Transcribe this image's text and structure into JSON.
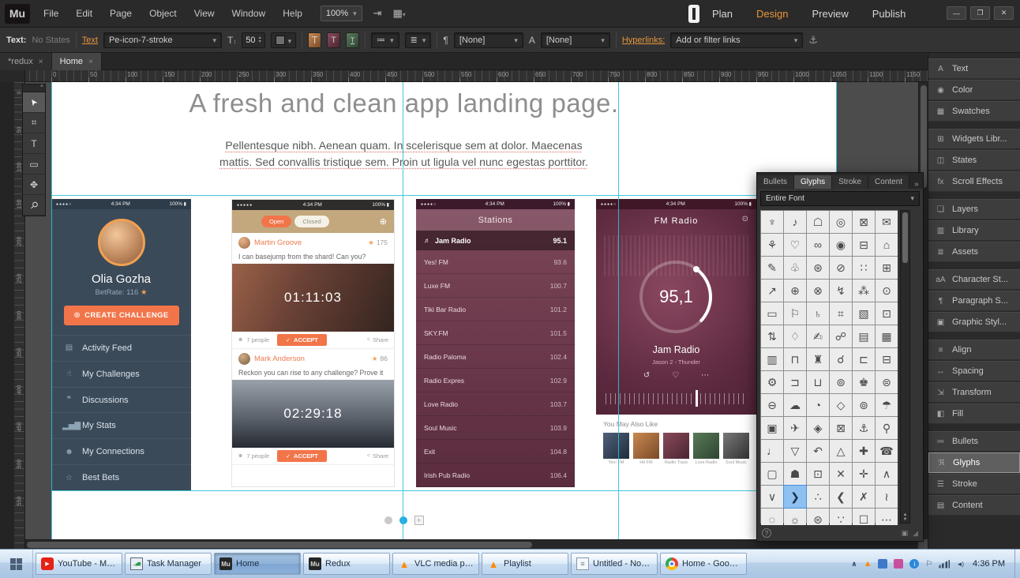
{
  "menubar": {
    "logo": "Mu",
    "menus": [
      "File",
      "Edit",
      "Page",
      "Object",
      "View",
      "Window",
      "Help"
    ],
    "zoom_value": "100%",
    "mode_tabs": [
      {
        "label": "Plan",
        "active": false
      },
      {
        "label": "Design",
        "active": true
      },
      {
        "label": "Preview",
        "active": false
      },
      {
        "label": "Publish",
        "active": false
      }
    ]
  },
  "control_bar": {
    "text_label": "Text:",
    "states_value": "No States",
    "text_link": "Text",
    "font_name": "Pe-icon-7-stroke",
    "font_size": "50",
    "paragraph_style": "[None]",
    "character_style": "[None]",
    "hyperlinks_label": "Hyperlinks:",
    "hyperlinks_value": "Add or filter links"
  },
  "doc_tabs": [
    {
      "label": "*redux",
      "active": false
    },
    {
      "label": "Home",
      "active": true
    }
  ],
  "rulers": {
    "h_labels": [
      "0",
      "50",
      "100",
      "150",
      "200",
      "250",
      "300",
      "350",
      "400",
      "450",
      "500",
      "550",
      "600",
      "650",
      "700",
      "750",
      "800",
      "850",
      "900",
      "950",
      "1000",
      "1050",
      "1100",
      "1150"
    ],
    "v_labels": [
      "0",
      "50",
      "100",
      "150",
      "200",
      "250",
      "300",
      "350",
      "400",
      "450",
      "500",
      "550"
    ]
  },
  "tools": [
    {
      "name": "selection-tool",
      "glyph": "➤"
    },
    {
      "name": "crop-tool",
      "glyph": "⌗"
    },
    {
      "name": "text-tool",
      "glyph": "T"
    },
    {
      "name": "rectangle-tool",
      "glyph": "▭"
    },
    {
      "name": "hand-tool",
      "glyph": "✥"
    },
    {
      "name": "zoom-tool",
      "glyph": "⚲"
    }
  ],
  "icons": {
    "star": "★",
    "people": "☻",
    "check": "✓",
    "share": "<",
    "add": "⊕",
    "speaker": "♬",
    "power": "⊙",
    "repeat": "↺",
    "heart": "♡",
    "more": "⋯"
  },
  "page": {
    "heading": "A fresh and clean app landing page.",
    "body_line1": "Pellentesque nibh. Aenean quam. In scelerisque sem at dolor. Maecenas",
    "body_line2": "mattis. Sed convallis tristique sem. Proin ut ligula vel nunc egestas porttitor."
  },
  "profile_card": {
    "status": {
      "dots": "●●●●○",
      "time": "4:34 PM",
      "battery": "100%"
    },
    "name": "Olia Gozha",
    "betrate_label": "BetRate:",
    "betrate_value": "116",
    "cta": "CREATE CHALLENGE",
    "menu": [
      {
        "icon": "▤",
        "label": "Activity Feed"
      },
      {
        "icon": "☝",
        "label": "My Challenges"
      },
      {
        "icon": "❞",
        "label": "Discussions"
      },
      {
        "icon": "▂▅▇",
        "label": "My Stats"
      },
      {
        "icon": "☻",
        "label": "My Connections"
      },
      {
        "icon": "☆",
        "label": "Best Bets"
      }
    ]
  },
  "challenge_card": {
    "status": {
      "dots": "●●●●●",
      "time": "4:34 PM",
      "battery": "100%"
    },
    "tabs": [
      {
        "label": "Open",
        "active": true
      },
      {
        "label": "Closed",
        "active": false
      }
    ],
    "posts": [
      {
        "name": "Martin Groove",
        "score": "175",
        "text": "I can basejump from the shard! Can you?",
        "timer": "01:11:03",
        "people": "7 people",
        "accept": "ACCEPT",
        "share": "Share"
      },
      {
        "name": "Mark Anderson",
        "score": "86",
        "text": "Reckon you can rise to any challenge? Prove it",
        "timer": "02:29:18",
        "people": "7 people",
        "accept": "ACCEPT",
        "share": "Share"
      }
    ]
  },
  "stations_card": {
    "status": {
      "dots": "●●●●○",
      "time": "4:34 PM",
      "battery": "100%"
    },
    "title": "Stations",
    "now_playing": {
      "name": "Jam Radio",
      "freq": "95.1"
    },
    "stations": [
      {
        "name": "Yes! FM",
        "freq": "93.6"
      },
      {
        "name": "Luxe FM",
        "freq": "100.7"
      },
      {
        "name": "Tiki Bar Radio",
        "freq": "101.2"
      },
      {
        "name": "SKY.FM",
        "freq": "101.5"
      },
      {
        "name": "Radio Paloma",
        "freq": "102.4"
      },
      {
        "name": "Radio Expres",
        "freq": "102.9"
      },
      {
        "name": "Love Radio",
        "freq": "103.7"
      },
      {
        "name": "Soul Music",
        "freq": "103.9"
      },
      {
        "name": "Exit",
        "freq": "104.8"
      },
      {
        "name": "Irish Pub Radio",
        "freq": "106.4"
      }
    ]
  },
  "fm_card": {
    "status": {
      "dots": "●●●●○",
      "time": "4:34 PM",
      "battery": "100%"
    },
    "title": "FM Radio",
    "freq": "95,1",
    "station": "Jam Radio",
    "track": "Jason 2 - Thunder",
    "also_like": "You May Also Like",
    "thumbs": [
      "Yes! FM",
      "Hit FM",
      "Radio Track",
      "Love Radio",
      "Soul Music"
    ]
  },
  "pagination": {
    "add_symbol": "+"
  },
  "glyphs_panel": {
    "tabs": [
      {
        "label": "Bullets",
        "active": false
      },
      {
        "label": "Glyphs",
        "active": true
      },
      {
        "label": "Stroke",
        "active": false
      },
      {
        "label": "Content",
        "active": false
      }
    ],
    "overflow": "»",
    "font_filter": "Entire Font",
    "selected_index": 73,
    "glyphs": [
      "♆",
      "♪",
      "☖",
      "◎",
      "⊠",
      "✉",
      "⚘",
      "♡",
      "∞",
      "◉",
      "⊟",
      "⌂",
      "✎",
      "♧",
      "⊛",
      "⊘",
      "∷",
      "⊞",
      "↗",
      "⊕",
      "⊗",
      "↯",
      "⁂",
      "⊙",
      "▭",
      "⚐",
      "♄",
      "⌗",
      "▧",
      "⊡",
      "⇅",
      "♢",
      "✍",
      "☍",
      "▤",
      "▦",
      "▥",
      "⊓",
      "♜",
      "☌",
      "⊏",
      "⊟",
      "⚙",
      "⊐",
      "⊔",
      "⊚",
      "♚",
      "⊜",
      "⊖",
      "☁",
      "◔",
      "◇",
      "⊚",
      "☂",
      "▣",
      "✈",
      "◈",
      "⊠",
      "⚓",
      "⚲",
      "♩",
      "▽",
      "↶",
      "△",
      "✚",
      "☎",
      "▢",
      "☗",
      "⊡",
      "✕",
      "✛",
      "∧",
      "∨",
      "❯",
      "∴",
      "❮",
      "✗",
      "≀",
      "◌",
      "☼",
      "⊜",
      "∵",
      "☐",
      "⋯"
    ],
    "help": "?"
  },
  "panel_dock": {
    "collapse": "«",
    "active_label": "Glyphs",
    "groups": [
      [
        {
          "icon": "A",
          "label": "Text"
        },
        {
          "icon": "◉",
          "label": "Color"
        },
        {
          "icon": "▦",
          "label": "Swatches"
        }
      ],
      [
        {
          "icon": "⊞",
          "label": "Widgets Libr..."
        },
        {
          "icon": "◫",
          "label": "States"
        },
        {
          "icon": "fx",
          "label": "Scroll Effects"
        }
      ],
      [
        {
          "icon": "❏",
          "label": "Layers"
        },
        {
          "icon": "▥",
          "label": "Library"
        },
        {
          "icon": "≣",
          "label": "Assets"
        }
      ],
      [
        {
          "icon": "aA",
          "label": "Character St..."
        },
        {
          "icon": "¶",
          "label": "Paragraph S..."
        },
        {
          "icon": "▣",
          "label": "Graphic Styl..."
        }
      ],
      [
        {
          "icon": "≡",
          "label": "Align"
        },
        {
          "icon": "↔",
          "label": "Spacing"
        },
        {
          "icon": "⇲",
          "label": "Transform"
        },
        {
          "icon": "◧",
          "label": "Fill"
        }
      ],
      [
        {
          "icon": "≔",
          "label": "Bullets"
        },
        {
          "icon": "ℜ",
          "label": "Glyphs"
        },
        {
          "icon": "☰",
          "label": "Stroke"
        },
        {
          "icon": "▤",
          "label": "Content"
        }
      ]
    ]
  },
  "taskbar": {
    "buttons": [
      {
        "icon": "youtube",
        "label": "YouTube - Mo...",
        "active": false
      },
      {
        "icon": "taskmgr",
        "label": "Task Manager",
        "active": false
      },
      {
        "icon": "muse",
        "label": "Home",
        "active": true
      },
      {
        "icon": "muse",
        "label": "Redux",
        "active": false
      },
      {
        "icon": "vlc",
        "label": "VLC media pla...",
        "active": false
      },
      {
        "icon": "vlc",
        "label": "Playlist",
        "active": false
      },
      {
        "icon": "notepad",
        "label": "Untitled - Note...",
        "active": false
      },
      {
        "icon": "chrome",
        "label": "Home - Googl...",
        "active": false
      }
    ],
    "tray_icons": [
      "chevron-up",
      "vlc-tray",
      "blue-app",
      "magenta-app",
      "info",
      "flag",
      "network",
      "volume"
    ],
    "clock": "4:36 PM"
  }
}
